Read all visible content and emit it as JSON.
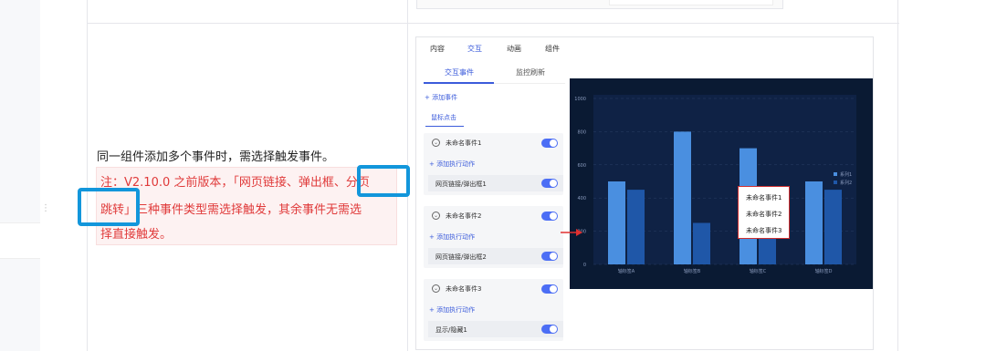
{
  "description": {
    "text": "同一组件添加多个事件时，需选择触发事件。",
    "note_lines": [
      "注：V2.10.0 之前版本，「网页链接、弹出框、分页",
      "跳转」三种事件类型需选择触发，其余事件无需选",
      "择直接触发。"
    ]
  },
  "editor": {
    "tabs": [
      "内容",
      "交互",
      "动画",
      "组件"
    ],
    "active_tab": "交互",
    "subtabs": [
      "交互事件",
      "监控刷新"
    ],
    "active_subtab": "交互事件",
    "add_event": "+ 添加事件",
    "trigger": "鼠标点击",
    "events": [
      {
        "name": "未命名事件1",
        "add_action": "+ 添加执行动作",
        "action": "网页链接/弹出框1"
      },
      {
        "name": "未命名事件2",
        "add_action": "+ 添加执行动作",
        "action": "网页链接/弹出框2"
      },
      {
        "name": "未命名事件3",
        "add_action": "+ 添加执行动作",
        "action": "显示/隐藏1"
      }
    ]
  },
  "chart_data": {
    "type": "bar",
    "categories": [
      "轴标签A",
      "轴标签B",
      "轴标签C",
      "轴标签D"
    ],
    "series": [
      {
        "name": "系列1",
        "values": [
          500,
          800,
          700,
          500
        ]
      },
      {
        "name": "系列2",
        "values": [
          450,
          250,
          450,
          450
        ]
      }
    ],
    "yticks": [
      "0",
      "200",
      "400",
      "600",
      "800",
      "1000"
    ],
    "ylim": [
      0,
      1000
    ],
    "legend_position": "right",
    "colors": {
      "series1": "#4a8fe0",
      "series2": "#1f57a8",
      "background": "#0a1a33"
    }
  },
  "tooltip": {
    "items": [
      "未命名事件1",
      "未命名事件2",
      "未命名事件3"
    ]
  },
  "colors": {
    "accent": "#3b5bdb",
    "highlight": "#1296db",
    "note_red": "#e03a3a"
  }
}
